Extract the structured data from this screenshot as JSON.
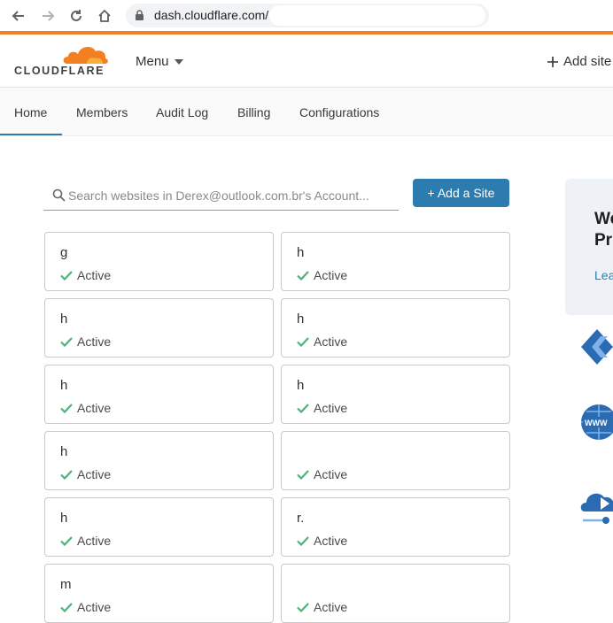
{
  "browser": {
    "url_text": "dash.cloudflare.com/"
  },
  "header": {
    "logo_text": "CLOUDFLARE",
    "menu_label": "Menu",
    "add_site_label": "Add site"
  },
  "tabs": [
    {
      "label": "Home",
      "active": true
    },
    {
      "label": "Members"
    },
    {
      "label": "Audit Log"
    },
    {
      "label": "Billing"
    },
    {
      "label": "Configurations"
    }
  ],
  "search": {
    "placeholder": "Search websites in Derex@outlook.com.br's Account..."
  },
  "add_site_button": "+ Add a Site",
  "sites": [
    {
      "name": "g",
      "status": "Active"
    },
    {
      "name": "h",
      "status": "Active"
    },
    {
      "name": "h",
      "status": "Active"
    },
    {
      "name": "h",
      "status": "Active"
    },
    {
      "name": "h",
      "status": "Active"
    },
    {
      "name": "h",
      "status": "Active"
    },
    {
      "name": "h",
      "status": "Active"
    },
    {
      "name": "",
      "status": "Active"
    },
    {
      "name": "h",
      "status": "Active"
    },
    {
      "name": "r.",
      "status": "Active"
    },
    {
      "name": "m",
      "status": "Active"
    },
    {
      "name": "",
      "status": "Active"
    }
  ],
  "right_panel": {
    "title_line1": "We",
    "title_line2": "Pr",
    "link": "Lea"
  },
  "icons": {
    "search": "search-icon",
    "check": "check-icon"
  },
  "colors": {
    "accent": "#f38020",
    "primary": "#2c7cb0",
    "active_green": "#4db37a"
  }
}
